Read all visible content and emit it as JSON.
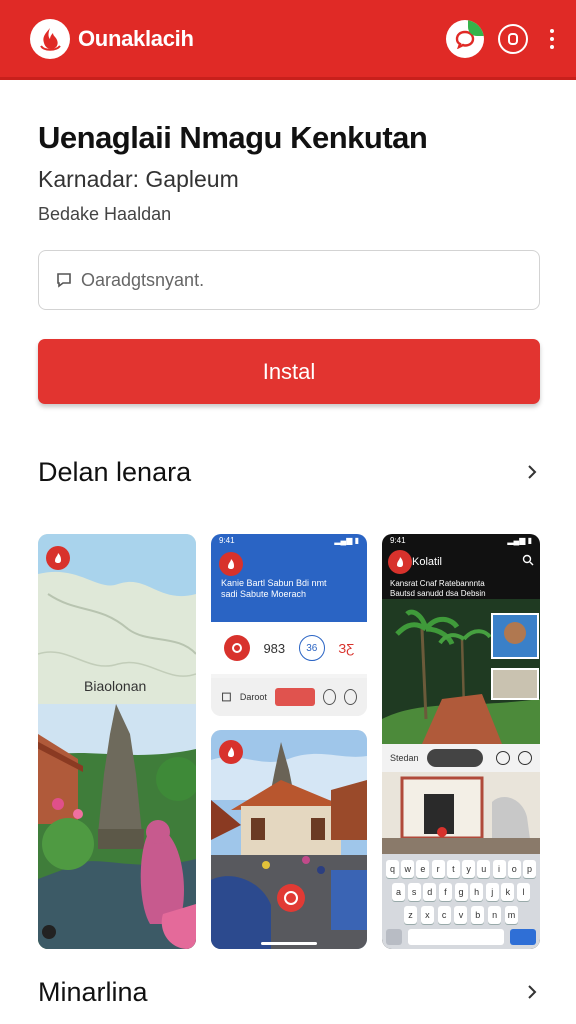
{
  "header": {
    "app_name": "Ounaklacih",
    "colors": {
      "brand_red": "#e02a26",
      "accent_green": "#35b34a"
    },
    "icons": [
      "flame-logo-icon",
      "chat-icon",
      "notification-icon",
      "more-vert-icon"
    ]
  },
  "main": {
    "title": "Uenaglaii Nmagu Kenkutan",
    "subtitle": "Karnadar: Gapleum",
    "caption": "Bedake Haaldan",
    "search": {
      "value": "Oaradgtsnyant."
    },
    "install_label": "Instal"
  },
  "screenshots_section": {
    "title": "Delan lenara",
    "items": [
      {
        "map_label": "Biaolonan"
      },
      {
        "status_time": "9:41",
        "header_text": "Kanie Bartl Sabun Bdi nmt sadi Sabute Moerach",
        "apps": [
          "983",
          "36",
          "ЗƸ"
        ],
        "bottom_label": "Daroot"
      },
      {
        "label": "photo-temple"
      },
      {
        "status_time": "9:41",
        "app_title": "Kolatil",
        "header_text": "Kansrat Cnaf Ratebannnta Bautsd sanudd dsa Debsin",
        "strip_label": "Stedan",
        "keyboard_rows": [
          "qwertyuiop",
          "asdfghjkl",
          "zxcvbnm"
        ]
      }
    ]
  },
  "next_section": {
    "title": "Minarlina"
  }
}
